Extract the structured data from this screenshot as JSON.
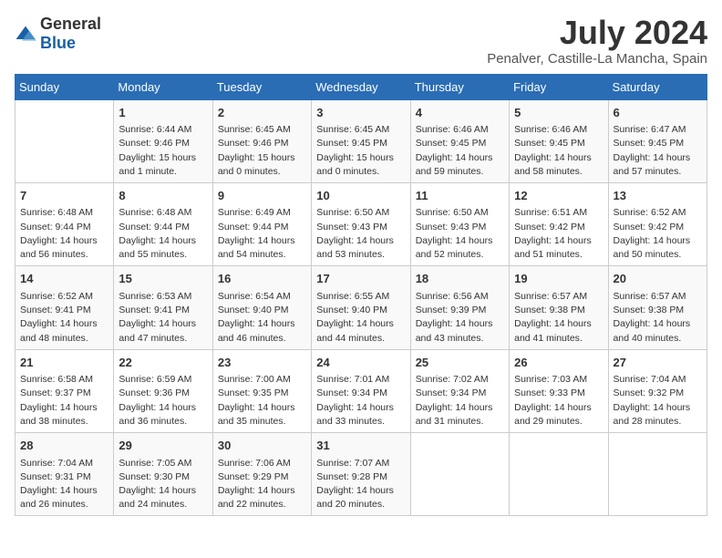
{
  "header": {
    "logo_general": "General",
    "logo_blue": "Blue",
    "month_year": "July 2024",
    "location": "Penalver, Castille-La Mancha, Spain"
  },
  "days_of_week": [
    "Sunday",
    "Monday",
    "Tuesday",
    "Wednesday",
    "Thursday",
    "Friday",
    "Saturday"
  ],
  "weeks": [
    [
      {
        "day": "",
        "info": ""
      },
      {
        "day": "1",
        "info": "Sunrise: 6:44 AM\nSunset: 9:46 PM\nDaylight: 15 hours\nand 1 minute."
      },
      {
        "day": "2",
        "info": "Sunrise: 6:45 AM\nSunset: 9:46 PM\nDaylight: 15 hours\nand 0 minutes."
      },
      {
        "day": "3",
        "info": "Sunrise: 6:45 AM\nSunset: 9:45 PM\nDaylight: 15 hours\nand 0 minutes."
      },
      {
        "day": "4",
        "info": "Sunrise: 6:46 AM\nSunset: 9:45 PM\nDaylight: 14 hours\nand 59 minutes."
      },
      {
        "day": "5",
        "info": "Sunrise: 6:46 AM\nSunset: 9:45 PM\nDaylight: 14 hours\nand 58 minutes."
      },
      {
        "day": "6",
        "info": "Sunrise: 6:47 AM\nSunset: 9:45 PM\nDaylight: 14 hours\nand 57 minutes."
      }
    ],
    [
      {
        "day": "7",
        "info": "Sunrise: 6:48 AM\nSunset: 9:44 PM\nDaylight: 14 hours\nand 56 minutes."
      },
      {
        "day": "8",
        "info": "Sunrise: 6:48 AM\nSunset: 9:44 PM\nDaylight: 14 hours\nand 55 minutes."
      },
      {
        "day": "9",
        "info": "Sunrise: 6:49 AM\nSunset: 9:44 PM\nDaylight: 14 hours\nand 54 minutes."
      },
      {
        "day": "10",
        "info": "Sunrise: 6:50 AM\nSunset: 9:43 PM\nDaylight: 14 hours\nand 53 minutes."
      },
      {
        "day": "11",
        "info": "Sunrise: 6:50 AM\nSunset: 9:43 PM\nDaylight: 14 hours\nand 52 minutes."
      },
      {
        "day": "12",
        "info": "Sunrise: 6:51 AM\nSunset: 9:42 PM\nDaylight: 14 hours\nand 51 minutes."
      },
      {
        "day": "13",
        "info": "Sunrise: 6:52 AM\nSunset: 9:42 PM\nDaylight: 14 hours\nand 50 minutes."
      }
    ],
    [
      {
        "day": "14",
        "info": "Sunrise: 6:52 AM\nSunset: 9:41 PM\nDaylight: 14 hours\nand 48 minutes."
      },
      {
        "day": "15",
        "info": "Sunrise: 6:53 AM\nSunset: 9:41 PM\nDaylight: 14 hours\nand 47 minutes."
      },
      {
        "day": "16",
        "info": "Sunrise: 6:54 AM\nSunset: 9:40 PM\nDaylight: 14 hours\nand 46 minutes."
      },
      {
        "day": "17",
        "info": "Sunrise: 6:55 AM\nSunset: 9:40 PM\nDaylight: 14 hours\nand 44 minutes."
      },
      {
        "day": "18",
        "info": "Sunrise: 6:56 AM\nSunset: 9:39 PM\nDaylight: 14 hours\nand 43 minutes."
      },
      {
        "day": "19",
        "info": "Sunrise: 6:57 AM\nSunset: 9:38 PM\nDaylight: 14 hours\nand 41 minutes."
      },
      {
        "day": "20",
        "info": "Sunrise: 6:57 AM\nSunset: 9:38 PM\nDaylight: 14 hours\nand 40 minutes."
      }
    ],
    [
      {
        "day": "21",
        "info": "Sunrise: 6:58 AM\nSunset: 9:37 PM\nDaylight: 14 hours\nand 38 minutes."
      },
      {
        "day": "22",
        "info": "Sunrise: 6:59 AM\nSunset: 9:36 PM\nDaylight: 14 hours\nand 36 minutes."
      },
      {
        "day": "23",
        "info": "Sunrise: 7:00 AM\nSunset: 9:35 PM\nDaylight: 14 hours\nand 35 minutes."
      },
      {
        "day": "24",
        "info": "Sunrise: 7:01 AM\nSunset: 9:34 PM\nDaylight: 14 hours\nand 33 minutes."
      },
      {
        "day": "25",
        "info": "Sunrise: 7:02 AM\nSunset: 9:34 PM\nDaylight: 14 hours\nand 31 minutes."
      },
      {
        "day": "26",
        "info": "Sunrise: 7:03 AM\nSunset: 9:33 PM\nDaylight: 14 hours\nand 29 minutes."
      },
      {
        "day": "27",
        "info": "Sunrise: 7:04 AM\nSunset: 9:32 PM\nDaylight: 14 hours\nand 28 minutes."
      }
    ],
    [
      {
        "day": "28",
        "info": "Sunrise: 7:04 AM\nSunset: 9:31 PM\nDaylight: 14 hours\nand 26 minutes."
      },
      {
        "day": "29",
        "info": "Sunrise: 7:05 AM\nSunset: 9:30 PM\nDaylight: 14 hours\nand 24 minutes."
      },
      {
        "day": "30",
        "info": "Sunrise: 7:06 AM\nSunset: 9:29 PM\nDaylight: 14 hours\nand 22 minutes."
      },
      {
        "day": "31",
        "info": "Sunrise: 7:07 AM\nSunset: 9:28 PM\nDaylight: 14 hours\nand 20 minutes."
      },
      {
        "day": "",
        "info": ""
      },
      {
        "day": "",
        "info": ""
      },
      {
        "day": "",
        "info": ""
      }
    ]
  ]
}
